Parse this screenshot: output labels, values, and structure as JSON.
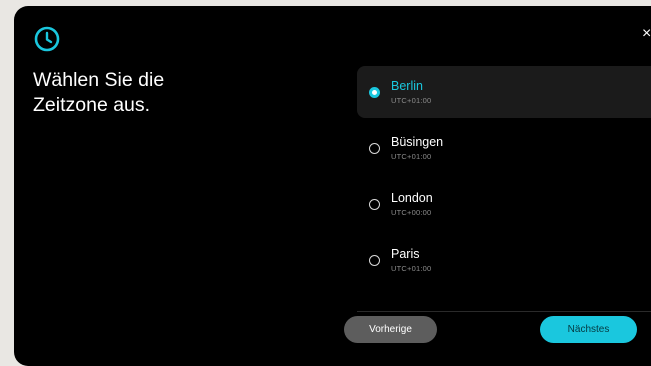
{
  "header": {
    "icon": "clock-icon",
    "title_line1": "Wählen Sie die",
    "title_line2": "Zeitzone aus.",
    "close_label": "×",
    "accent_color": "#1ac7de"
  },
  "timezones": [
    {
      "city": "Berlin",
      "offset": "UTC+01:00",
      "selected": true
    },
    {
      "city": "Büsingen",
      "offset": "UTC+01:00",
      "selected": false
    },
    {
      "city": "London",
      "offset": "UTC+00:00",
      "selected": false
    },
    {
      "city": "Paris",
      "offset": "UTC+01:00",
      "selected": false
    }
  ],
  "footer": {
    "prev_label": "Vorherige",
    "next_label": "Nächstes"
  }
}
